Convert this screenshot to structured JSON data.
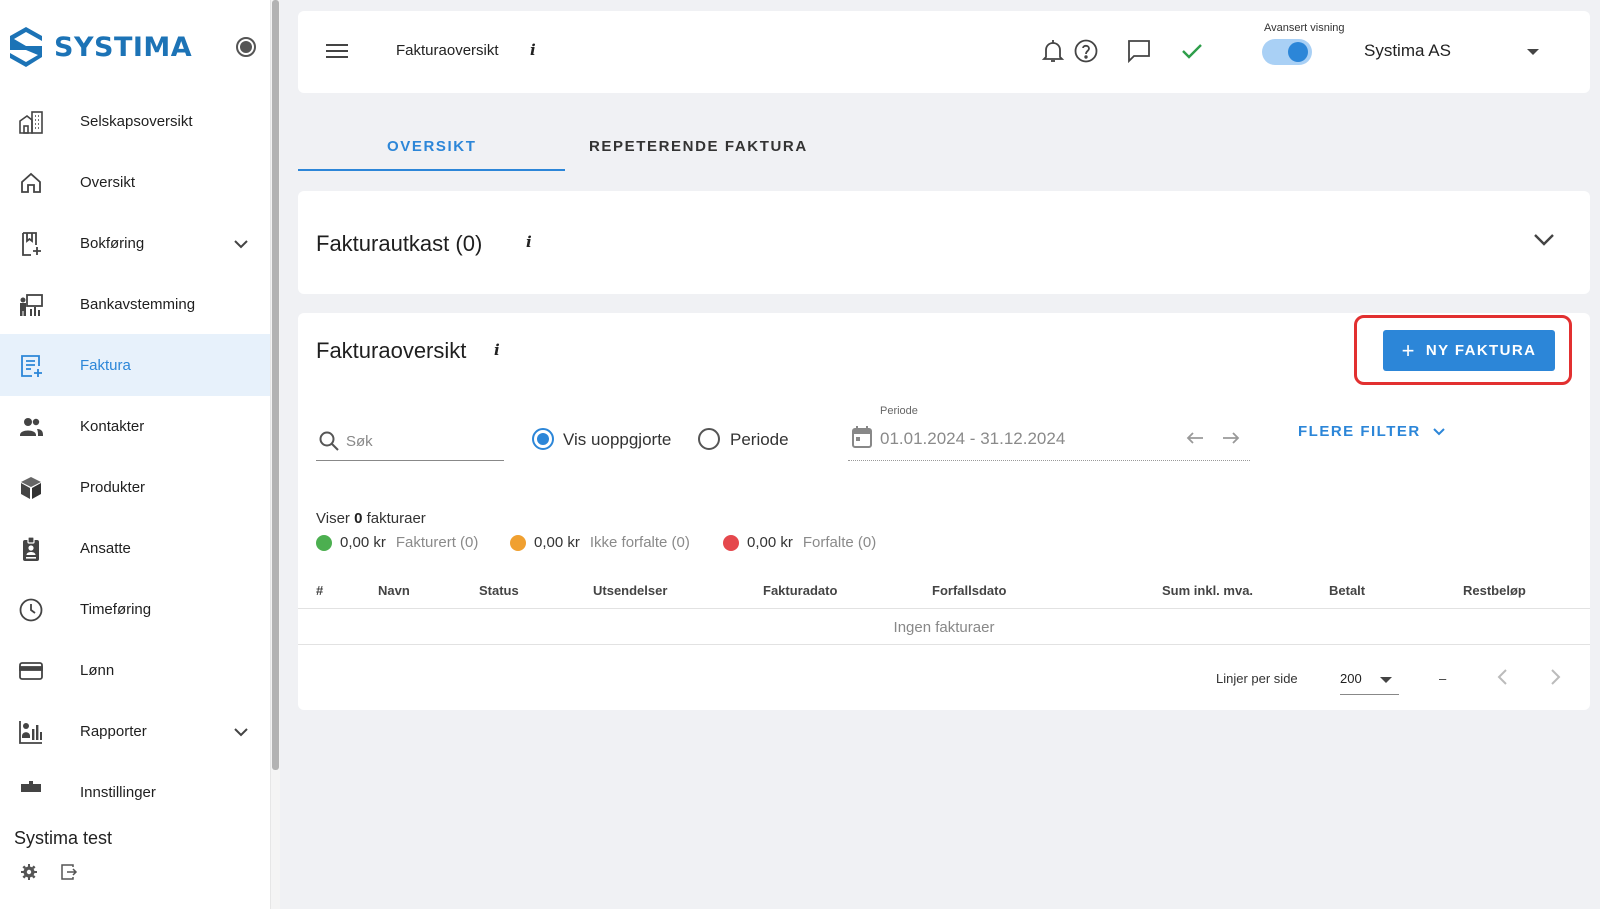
{
  "app": {
    "logo_text": "SYSTIMA",
    "brand_color": "#1c73b6",
    "accent_color": "#2c86d8",
    "highlight_color": "#e23030"
  },
  "sidebar": {
    "items": [
      {
        "label": "Selskapsoversikt",
        "icon": "building-icon"
      },
      {
        "label": "Oversikt",
        "icon": "home-icon"
      },
      {
        "label": "Bokføring",
        "icon": "bookkeeping-icon",
        "expandable": true
      },
      {
        "label": "Bankavstemming",
        "icon": "bank-reconciliation-icon"
      },
      {
        "label": "Faktura",
        "icon": "invoice-icon",
        "active": true
      },
      {
        "label": "Kontakter",
        "icon": "contacts-icon"
      },
      {
        "label": "Produkter",
        "icon": "product-box-icon"
      },
      {
        "label": "Ansatte",
        "icon": "employee-badge-icon"
      },
      {
        "label": "Timeføring",
        "icon": "clock-icon"
      },
      {
        "label": "Lønn",
        "icon": "credit-card-icon"
      },
      {
        "label": "Rapporter",
        "icon": "reports-icon",
        "expandable": true
      },
      {
        "label": "Innstillinger",
        "icon": "settings-icon"
      }
    ],
    "footer_name": "Systima test"
  },
  "topbar": {
    "title": "Fakturaoversikt",
    "info": "i",
    "advanced_view_label": "Avansert visning",
    "advanced_view_on": true,
    "company": "Systima AS"
  },
  "tabs": [
    {
      "label": "OVERSIKT",
      "active": true
    },
    {
      "label": "REPETERENDE FAKTURA",
      "active": false
    }
  ],
  "drafts": {
    "title": "Fakturautkast (0)",
    "info": "i"
  },
  "invoices": {
    "title": "Fakturaoversikt",
    "info": "i",
    "new_button": "NY FAKTURA",
    "search_placeholder": "Søk",
    "radio_unsettled": "Vis uoppgjorte",
    "radio_period": "Periode",
    "selected_filter": "Vis uoppgjorte",
    "period_caption": "Periode",
    "period_value": "01.01.2024 - 31.12.2024",
    "more_filters": "FLERE FILTER",
    "showing_prefix": "Viser",
    "showing_count": "0",
    "showing_suffix": "fakturaer",
    "stats": [
      {
        "amount": "0,00 kr",
        "label": "Fakturert (0)",
        "color": "#4caf50"
      },
      {
        "amount": "0,00 kr",
        "label": "Ikke forfalte (0)",
        "color": "#f0a030"
      },
      {
        "amount": "0,00 kr",
        "label": "Forfalte (0)",
        "color": "#e5484d"
      }
    ],
    "columns": [
      "#",
      "Navn",
      "Status",
      "Utsendelser",
      "Fakturadato",
      "Forfallsdato",
      "Sum inkl. mva.",
      "Betalt",
      "Restbeløp"
    ],
    "empty_message": "Ingen fakturaer",
    "rows_per_page_label": "Linjer per side",
    "rows_per_page": "200",
    "range": "–"
  }
}
